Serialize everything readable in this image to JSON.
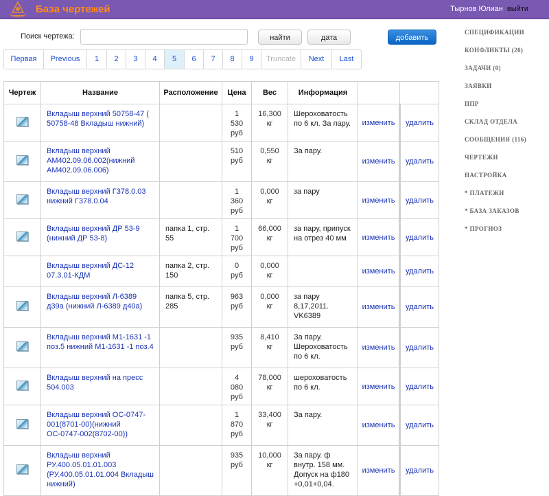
{
  "header": {
    "title": "База чертежей",
    "user_name": "Тырнов Юлиан",
    "logout": "выйти",
    "logo_color": "#e0893a"
  },
  "search": {
    "label": "Поиск чертежа:",
    "value": "",
    "placeholder": "",
    "find_label": "найти",
    "date_label": "дата",
    "add_label": "добавить"
  },
  "pagination": {
    "first": "Первая",
    "previous": "Previous",
    "pages": [
      "1",
      "2",
      "3",
      "4",
      "5",
      "6",
      "7",
      "8",
      "9"
    ],
    "active": "5",
    "truncate": "Truncate",
    "next": "Next",
    "last": "Last"
  },
  "table": {
    "headers": {
      "drawing": "Чертеж",
      "name": "Название",
      "location": "Расположение",
      "price": "Цена",
      "weight": "Вес",
      "info": "Информация"
    },
    "edit_label": "изменить",
    "delete_label": "удалить",
    "rows": [
      {
        "has_image": true,
        "name": "Вкладыш верхний 50758-47 ( 50758-48 Вкладыш нижний)",
        "location": "",
        "price": "1 530 руб",
        "weight": "16,300 кг",
        "info": "Шероховатость по 6 кл. За пару."
      },
      {
        "has_image": true,
        "name": "Вкладыш верхний АМ402.09.06.002(нижний АМ402.09.06.006)",
        "location": "",
        "price": "510 руб",
        "weight": "0,550 кг",
        "info": "За пару."
      },
      {
        "has_image": true,
        "name": "Вкладыш верхний Г378.0.03 нижний Г378.0.04",
        "location": "",
        "price": "1 360 руб",
        "weight": "0,000 кг",
        "info": "за пару"
      },
      {
        "has_image": true,
        "name": "Вкладыш верхний ДР 53-9 (нижний ДР 53-8)",
        "location": "папка 1, стр. 55",
        "price": "1 700 руб",
        "weight": "66,000 кг",
        "info": "за пару, припуск на отрез 40 мм"
      },
      {
        "has_image": false,
        "name": "Вкладыш верхний ДС-12 07.3.01-КДМ",
        "location": "папка 2, стр. 150",
        "price": "0 руб",
        "weight": "0,000 кг",
        "info": ""
      },
      {
        "has_image": true,
        "name": "Вкладыш верхний Л-6389 д39а (нижний Л-6389 д40а)",
        "location": "папка 5, стр. 285",
        "price": "963 руб",
        "weight": "0,000 кг",
        "info": "за пару 8,17,2011. VK6389"
      },
      {
        "has_image": true,
        "name": "Вкладыш верхний М1-1631 -1 поз.5 нижний М1-1631 -1 поз.4",
        "location": "",
        "price": "935 руб",
        "weight": "8,410 кг",
        "info": "За пару. Шероховатость по 6 кл."
      },
      {
        "has_image": true,
        "name": "Вкладыш верхний на пресс 504.003",
        "location": "",
        "price": "4 080 руб",
        "weight": "78,000 кг",
        "info": "шероховатость по 6 кл."
      },
      {
        "has_image": true,
        "name": "Вкладыш верхний ОС-0747-001(8701-00)(нижний ОС-0747-002(8702-00))",
        "location": "",
        "price": "1 870 руб",
        "weight": "33,400 кг",
        "info": "За пару."
      },
      {
        "has_image": true,
        "name": "Вкладыш верхний РУ.400.05.01.01.003 (РУ.400.05.01.01.004 Вкладыш нижний)",
        "location": "",
        "price": "935 руб",
        "weight": "10,000 кг",
        "info": "За пару. ф внутр. 158 мм. Допуск на ф180 +0,01+0,04."
      }
    ]
  },
  "sidenav": {
    "items": [
      "СПЕЦИФИКАЦИИ",
      "КОНФЛИКТЫ (20)",
      "ЗАДАЧИ (0)",
      "ЗАЯВКИ",
      "ППР",
      "СКЛАД ОТДЕЛА",
      "СООБЩЕНИЯ (116)",
      "ЧЕРТЕЖИ",
      "НАСТРОЙКА",
      "* ПЛАТЕЖИ",
      "* БАЗА ЗАКАЗОВ",
      "* ПРОГНОЗ"
    ]
  }
}
